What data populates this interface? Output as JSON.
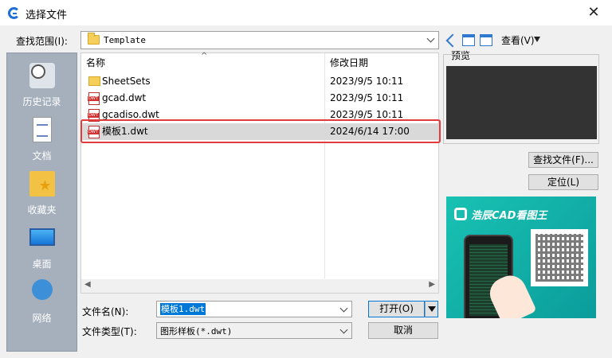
{
  "window": {
    "title": "选择文件",
    "close": "✕"
  },
  "lookin": {
    "label": "查找范围(I):",
    "value": "Template"
  },
  "toolbar": {
    "view_label": "查看(V)"
  },
  "places": [
    "历史记录",
    "文档",
    "收藏夹",
    "桌面",
    "网络"
  ],
  "filelist": {
    "col_name": "名称",
    "col_date": "修改日期",
    "sort_indicator": "^",
    "rows": [
      {
        "name": "SheetSets",
        "date": "2023/9/5 10:11",
        "type": "folder"
      },
      {
        "name": "gcad.dwt",
        "date": "2023/9/5 10:11",
        "type": "dwt"
      },
      {
        "name": "gcadiso.dwt",
        "date": "2023/9/5 10:11",
        "type": "dwt"
      },
      {
        "name": "模板1.dwt",
        "date": "2024/6/14 17:00",
        "type": "dwt",
        "selected": true
      }
    ]
  },
  "preview": {
    "label": "预览"
  },
  "side_buttons": {
    "find": "查找文件(F)...",
    "locate": "定位(L)"
  },
  "ad": {
    "title": "浩辰CAD看图王"
  },
  "bottom": {
    "filename_label": "文件名(N):",
    "filename_value": "模板1.dwt",
    "filetype_label": "文件类型(T):",
    "filetype_value": "图形样板(*.dwt)",
    "open": "打开(O)",
    "cancel": "取消"
  },
  "colors": {
    "highlight": "#e23b3b",
    "accent": "#0078d7",
    "places_bg": "#a6b0bd"
  }
}
